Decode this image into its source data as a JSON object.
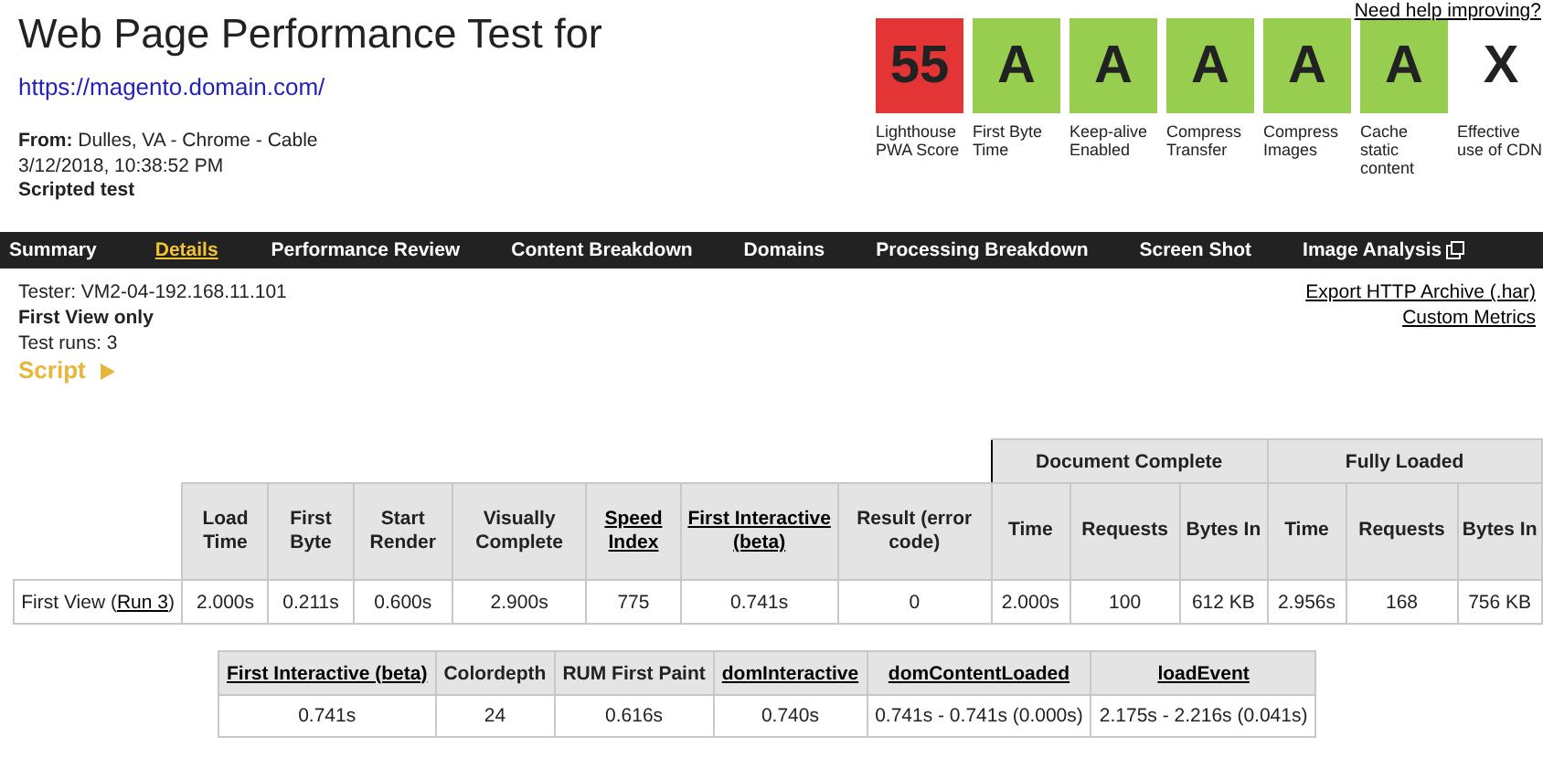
{
  "header": {
    "title": "Web Page Performance Test for",
    "url": "https://magento.domain.com/",
    "from_label": "From:",
    "from": "Dulles, VA - Chrome - Cable",
    "date": "3/12/2018, 10:38:52 PM",
    "test_type": "Scripted test",
    "help_link": "Need help improving?"
  },
  "grades": [
    {
      "grade": "55",
      "label": "Lighthouse PWA Score",
      "color": "#e33535"
    },
    {
      "grade": "A",
      "label": "First Byte Time",
      "color": "#98ce4f"
    },
    {
      "grade": "A",
      "label": "Keep-alive Enabled",
      "color": "#98ce4f"
    },
    {
      "grade": "A",
      "label": "Compress Transfer",
      "color": "#98ce4f"
    },
    {
      "grade": "A",
      "label": "Compress Images",
      "color": "#98ce4f"
    },
    {
      "grade": "A",
      "label": "Cache static content",
      "color": "#98ce4f"
    },
    {
      "grade": "X",
      "label": "Effective use of CDN",
      "color": "#ffffff"
    }
  ],
  "tabs": [
    {
      "label": "Summary",
      "selected": false,
      "external": false
    },
    {
      "label": "Details",
      "selected": true,
      "external": false
    },
    {
      "label": "Performance Review",
      "selected": false,
      "external": false
    },
    {
      "label": "Content Breakdown",
      "selected": false,
      "external": false
    },
    {
      "label": "Domains",
      "selected": false,
      "external": false
    },
    {
      "label": "Processing Breakdown",
      "selected": false,
      "external": false
    },
    {
      "label": "Screen Shot",
      "selected": false,
      "external": false
    },
    {
      "label": "Image Analysis",
      "selected": false,
      "external": true
    }
  ],
  "info": {
    "tester": "Tester: VM2-04-192.168.11.101",
    "view": "First View only",
    "runs": "Test runs: 3",
    "script": "Script",
    "script_expanded": false,
    "export_link": "Export HTTP Archive (.har)",
    "metrics_link": "Custom Metrics"
  },
  "results": {
    "groups": [
      "Document Complete",
      "Fully Loaded"
    ],
    "columns": [
      {
        "label": "Load Time",
        "link": false
      },
      {
        "label": "First Byte",
        "link": false
      },
      {
        "label": "Start Render",
        "link": false
      },
      {
        "label": "Visually Complete",
        "link": false
      },
      {
        "label": "Speed Index",
        "link": true
      },
      {
        "label": "First Interactive (beta)",
        "link": true
      },
      {
        "label": "Result (error code)",
        "link": false
      },
      {
        "label": "Time",
        "link": false
      },
      {
        "label": "Requests",
        "link": false
      },
      {
        "label": "Bytes In",
        "link": false
      },
      {
        "label": "Time",
        "link": false
      },
      {
        "label": "Requests",
        "link": false
      },
      {
        "label": "Bytes In",
        "link": false
      }
    ],
    "row": {
      "label": "First View (",
      "run_link": "Run 3",
      "label_end": ")",
      "values": [
        "2.000s",
        "0.211s",
        "0.600s",
        "2.900s",
        "775",
        "0.741s",
        "0",
        "2.000s",
        "100",
        "612 KB",
        "2.956s",
        "168",
        "756 KB"
      ]
    }
  },
  "metrics": {
    "columns": [
      {
        "label": "First Interactive (beta)",
        "link": true
      },
      {
        "label": "Colordepth",
        "link": false
      },
      {
        "label": "RUM First Paint",
        "link": false
      },
      {
        "label": "domInteractive",
        "link": true
      },
      {
        "label": "domContentLoaded",
        "link": true
      },
      {
        "label": "loadEvent",
        "link": true
      }
    ],
    "values": [
      "0.741s",
      "24",
      "0.616s",
      "0.740s",
      "0.741s - 0.741s (0.000s)",
      "2.175s - 2.216s (0.041s)"
    ]
  }
}
